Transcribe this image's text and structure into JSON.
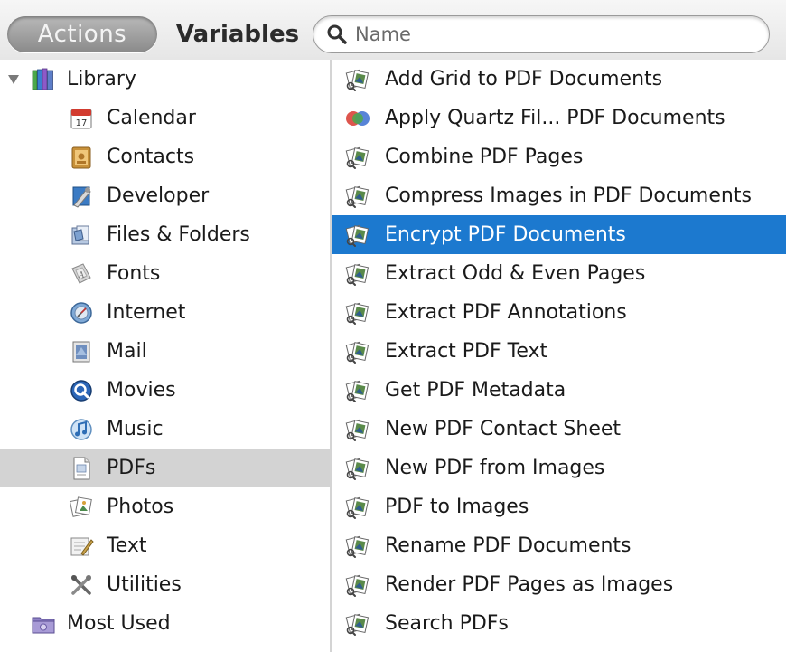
{
  "toolbar": {
    "actions_label": "Actions",
    "variables_label": "Variables",
    "search_placeholder": "Name"
  },
  "library": {
    "root": {
      "label": "Library",
      "icon": "library-icon"
    },
    "items": [
      {
        "label": "Calendar",
        "icon": "calendar-icon"
      },
      {
        "label": "Contacts",
        "icon": "contacts-icon"
      },
      {
        "label": "Developer",
        "icon": "developer-icon"
      },
      {
        "label": "Files & Folders",
        "icon": "files-folders-icon"
      },
      {
        "label": "Fonts",
        "icon": "fonts-icon"
      },
      {
        "label": "Internet",
        "icon": "internet-icon"
      },
      {
        "label": "Mail",
        "icon": "mail-icon"
      },
      {
        "label": "Movies",
        "icon": "movies-icon"
      },
      {
        "label": "Music",
        "icon": "music-icon"
      },
      {
        "label": "PDFs",
        "icon": "pdfs-icon",
        "selected": true
      },
      {
        "label": "Photos",
        "icon": "photos-icon"
      },
      {
        "label": "Text",
        "icon": "text-icon"
      },
      {
        "label": "Utilities",
        "icon": "utilities-icon"
      }
    ],
    "most_used": {
      "label": "Most Used",
      "icon": "smart-folder-icon"
    }
  },
  "actions": [
    {
      "label": "Add Grid to PDF Documents",
      "icon": "preview-action-icon"
    },
    {
      "label": "Apply Quartz Fil... PDF Documents",
      "icon": "quartz-filter-icon"
    },
    {
      "label": "Combine PDF Pages",
      "icon": "preview-action-icon"
    },
    {
      "label": "Compress Images in PDF Documents",
      "icon": "preview-action-icon"
    },
    {
      "label": "Encrypt PDF Documents",
      "icon": "preview-action-icon",
      "selected": true
    },
    {
      "label": "Extract Odd & Even Pages",
      "icon": "preview-action-icon"
    },
    {
      "label": "Extract PDF Annotations",
      "icon": "preview-action-icon"
    },
    {
      "label": "Extract PDF Text",
      "icon": "preview-action-icon"
    },
    {
      "label": "Get PDF Metadata",
      "icon": "preview-action-icon"
    },
    {
      "label": "New PDF Contact Sheet",
      "icon": "preview-action-icon"
    },
    {
      "label": "New PDF from Images",
      "icon": "preview-action-icon"
    },
    {
      "label": "PDF to Images",
      "icon": "preview-action-icon"
    },
    {
      "label": "Rename PDF Documents",
      "icon": "preview-action-icon"
    },
    {
      "label": "Render PDF Pages as Images",
      "icon": "preview-action-icon"
    },
    {
      "label": "Search PDFs",
      "icon": "preview-action-icon"
    }
  ],
  "colors": {
    "selection_blue": "#1c79cf",
    "source_selection_gray": "#d3d3d3"
  }
}
